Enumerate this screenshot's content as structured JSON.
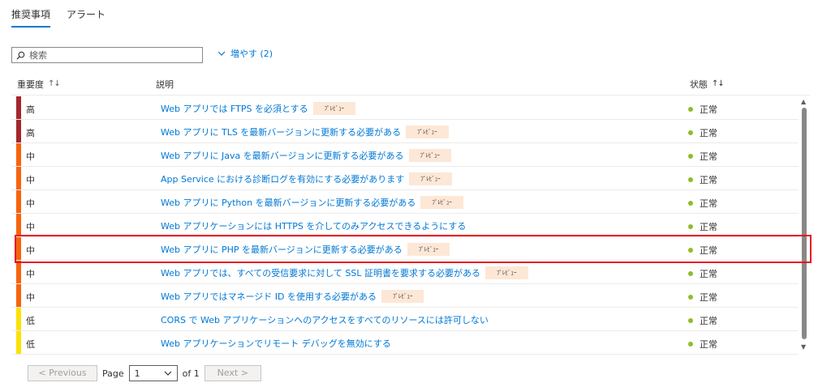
{
  "tabs": [
    {
      "label": "推奨事項",
      "active": true
    },
    {
      "label": "アラート",
      "active": false
    }
  ],
  "search": {
    "placeholder": "検索",
    "value": ""
  },
  "more_filters": {
    "label": "増やす (2)"
  },
  "table": {
    "columns": {
      "severity": "重要度",
      "description": "説明",
      "status": "状態"
    },
    "rows": [
      {
        "severity": "高",
        "severity_color": "#a4262c",
        "description": "Web アプリでは FTPS を必須とする",
        "badge": "ﾌﾟﾚﾋﾞｭｰ",
        "status": "正常"
      },
      {
        "severity": "高",
        "severity_color": "#a4262c",
        "description": "Web アプリに TLS を最新バージョンに更新する必要がある",
        "badge": "ﾌﾟﾚﾋﾞｭｰ",
        "status": "正常"
      },
      {
        "severity": "中",
        "severity_color": "#f7630c",
        "description": "Web アプリに Java を最新バージョンに更新する必要がある",
        "badge": "ﾌﾟﾚﾋﾞｭｰ",
        "status": "正常"
      },
      {
        "severity": "中",
        "severity_color": "#f7630c",
        "description": "App Service における診断ログを有効にする必要があります",
        "badge": "ﾌﾟﾚﾋﾞｭｰ",
        "status": "正常"
      },
      {
        "severity": "中",
        "severity_color": "#f7630c",
        "description": "Web アプリに Python を最新バージョンに更新する必要がある",
        "badge": "ﾌﾟﾚﾋﾞｭｰ",
        "status": "正常"
      },
      {
        "severity": "中",
        "severity_color": "#f7630c",
        "description": "Web アプリケーションには HTTPS を介してのみアクセスできるようにする",
        "badge": "",
        "status": "正常"
      },
      {
        "severity": "中",
        "severity_color": "#f7630c",
        "description": "Web アプリに PHP を最新バージョンに更新する必要がある",
        "badge": "ﾌﾟﾚﾋﾞｭｰ",
        "status": "正常"
      },
      {
        "severity": "中",
        "severity_color": "#f7630c",
        "description": "Web アプリでは、すべての受信要求に対して SSL 証明書を要求する必要がある",
        "badge": "ﾌﾟﾚﾋﾞｭｰ",
        "status": "正常"
      },
      {
        "severity": "中",
        "severity_color": "#f7630c",
        "description": "Web アプリではマネージド ID を使用する必要がある",
        "badge": "ﾌﾟﾚﾋﾞｭｰ",
        "status": "正常"
      },
      {
        "severity": "低",
        "severity_color": "#fce100",
        "description": "CORS で Web アプリケーションへのアクセスをすべてのリソースには許可しない",
        "badge": "",
        "status": "正常"
      },
      {
        "severity": "低",
        "severity_color": "#fce100",
        "description": "Web アプリケーションでリモート デバッグを無効にする",
        "badge": "",
        "status": "正常"
      }
    ]
  },
  "pager": {
    "prev": "< Previous",
    "page_label": "Page",
    "page_value": "1",
    "of_label": "of 1",
    "next": "Next >"
  },
  "colors": {
    "accent": "#0078d4",
    "healthy": "#8fbc2a",
    "highlight": "#e81123"
  },
  "icons": {
    "search": "search-icon",
    "expand": "chevron-down-icon",
    "sort": "sort-arrows-icon"
  }
}
